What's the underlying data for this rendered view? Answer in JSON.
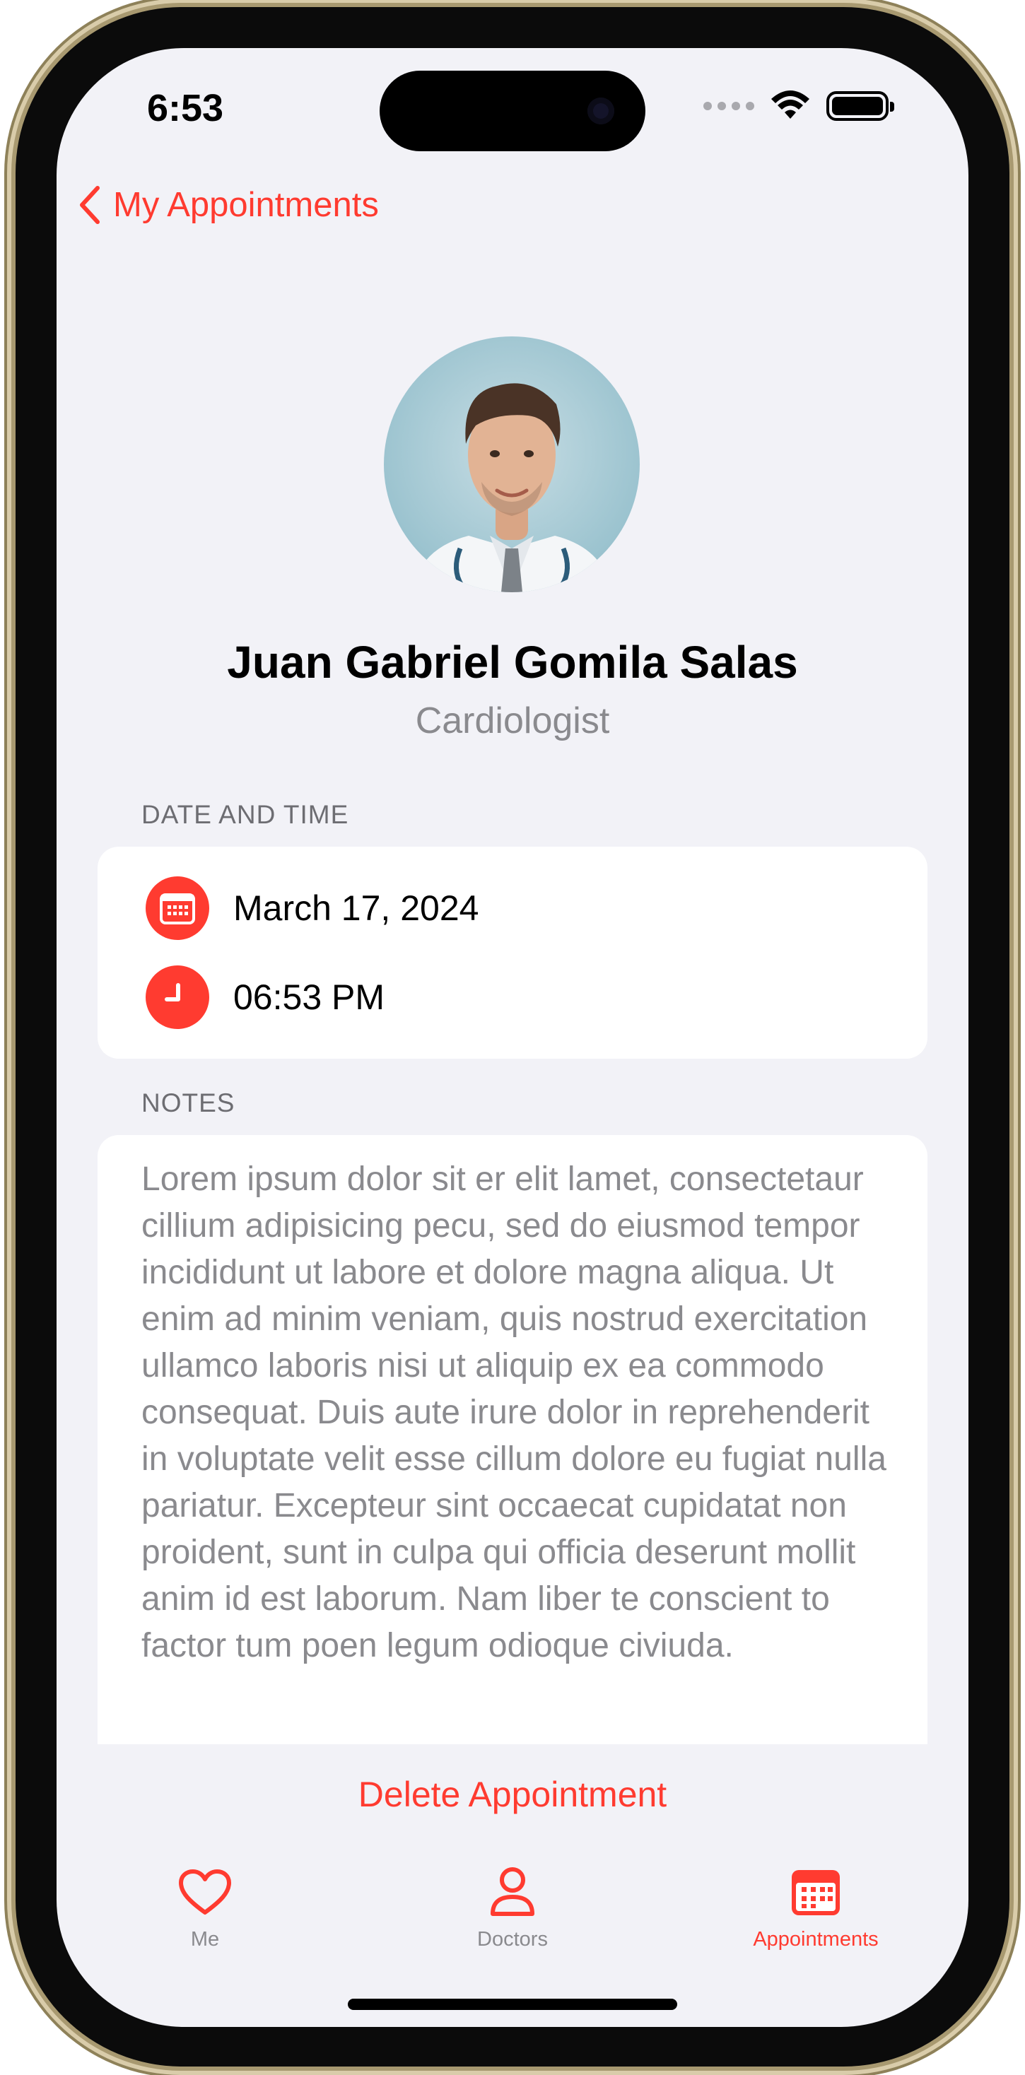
{
  "status_bar": {
    "time": "6:53"
  },
  "nav": {
    "back_label": "My Appointments"
  },
  "doctor": {
    "name": "Juan Gabriel Gomila Salas",
    "specialty": "Cardiologist"
  },
  "date_time": {
    "section_label": "DATE AND TIME",
    "date": "March 17, 2024",
    "time": "06:53 PM"
  },
  "notes": {
    "section_label": "NOTES",
    "text": "Lorem ipsum dolor sit er elit lamet, consectetaur cillium adipisicing pecu, sed do eiusmod tempor incididunt ut labore et dolore magna aliqua. Ut enim ad minim veniam, quis nostrud exercitation ullamco laboris nisi ut aliquip ex ea commodo consequat. Duis aute irure dolor in reprehenderit in voluptate velit esse cillum dolore eu fugiat nulla pariatur. Excepteur sint occaecat cupidatat non proident, sunt in culpa qui officia deserunt mollit anim id est laborum. Nam liber te conscient to factor tum poen legum odioque civiuda."
  },
  "actions": {
    "delete_label": "Delete Appointment"
  },
  "tab_bar": {
    "items": [
      {
        "label": "Me",
        "icon": "heart-icon"
      },
      {
        "label": "Doctors",
        "icon": "person-icon"
      },
      {
        "label": "Appointments",
        "icon": "calendar-icon",
        "active": true
      }
    ]
  },
  "colors": {
    "accent": "#ff3b30",
    "background": "#f2f2f7",
    "secondary_text": "#8a8a8e"
  }
}
